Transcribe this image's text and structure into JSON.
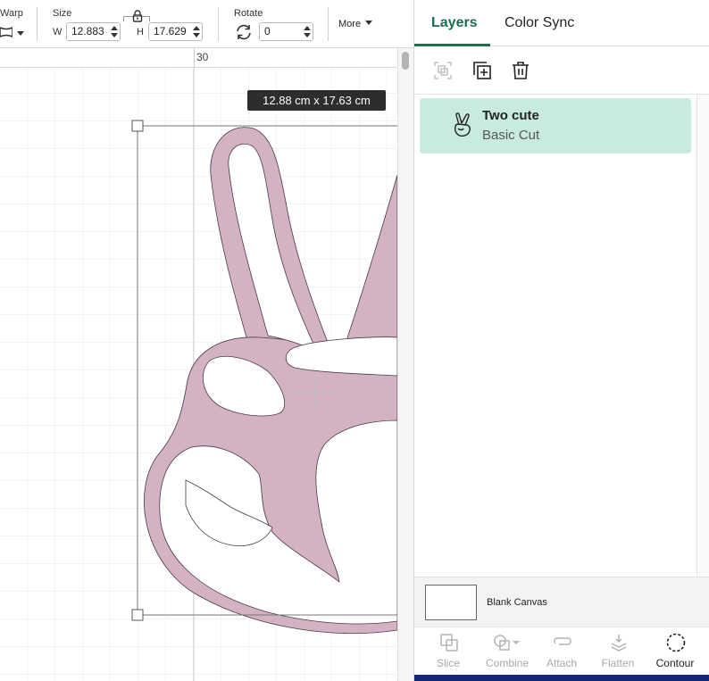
{
  "toolbar": {
    "warp_label": "Warp",
    "size_label": "Size",
    "width_label": "W",
    "width_value": "12.883",
    "height_label": "H",
    "height_value": "17.629",
    "rotate_label": "Rotate",
    "rotate_value": "0",
    "more_label": "More"
  },
  "canvas": {
    "ruler_label": "30",
    "dimension_tooltip": "12.88  cm x 17.63  cm"
  },
  "panel": {
    "tabs": [
      {
        "label": "Layers",
        "active": true
      },
      {
        "label": "Color Sync",
        "active": false
      }
    ],
    "tools": [
      "group-icon",
      "duplicate-icon",
      "delete-icon"
    ],
    "layers": [
      {
        "name": "Two cute",
        "operation": "Basic Cut",
        "icon": "peace-hand-icon"
      }
    ],
    "blank_canvas_label": "Blank Canvas",
    "actions": [
      {
        "label": "Slice",
        "icon": "slice-icon",
        "enabled": false
      },
      {
        "label": "Combine",
        "icon": "combine-icon",
        "enabled": false
      },
      {
        "label": "Attach",
        "icon": "attach-icon",
        "enabled": false
      },
      {
        "label": "Flatten",
        "icon": "flatten-icon",
        "enabled": false
      },
      {
        "label": "Contour",
        "icon": "contour-icon",
        "enabled": true
      }
    ]
  },
  "colors": {
    "accent": "#1b6e4c",
    "layer_selected_bg": "#c8ebde",
    "shape_fill": "#d3b2c3",
    "tooltip_bg": "#2d2d2d",
    "bottom_bar": "#15257a"
  }
}
